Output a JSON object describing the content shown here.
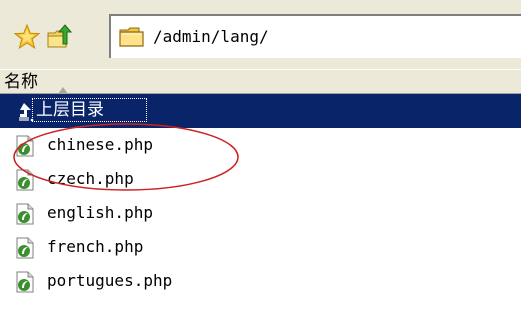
{
  "toolbar": {
    "icons": [
      "star-icon",
      "up-folder-icon"
    ],
    "address": {
      "icon": "folder-icon",
      "path": "/admin/lang/"
    }
  },
  "list_header": {
    "name_label": "名称",
    "sort": "ascending"
  },
  "files": [
    {
      "name": "上层目录",
      "icon": "parent-dir-icon",
      "selected": true
    },
    {
      "name": "chinese.php",
      "icon": "php-file-icon",
      "selected": false,
      "annotated": true
    },
    {
      "name": "czech.php",
      "icon": "php-file-icon",
      "selected": false
    },
    {
      "name": "english.php",
      "icon": "php-file-icon",
      "selected": false
    },
    {
      "name": "french.php",
      "icon": "php-file-icon",
      "selected": false
    },
    {
      "name": "portugues.php",
      "icon": "php-file-icon",
      "selected": false
    }
  ],
  "colors": {
    "toolbar_bg": "#ece9d8",
    "selection_bg": "#0a246a",
    "annotation": "#cc2222"
  }
}
